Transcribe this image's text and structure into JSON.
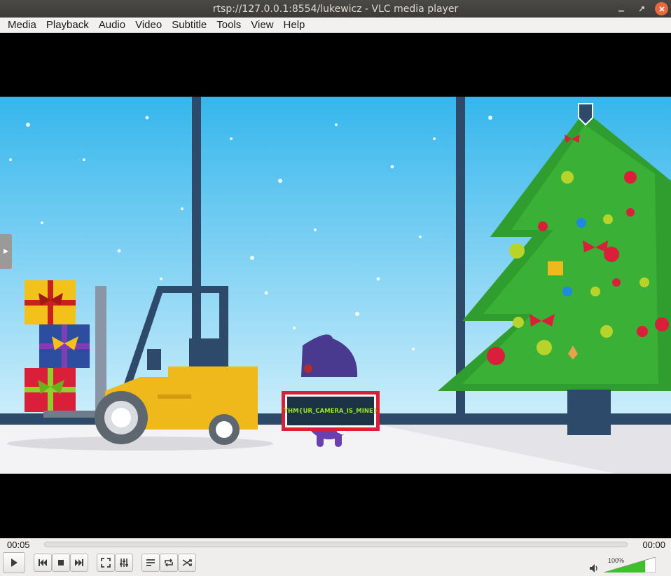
{
  "window": {
    "title": "rtsp://127.0.0.1:8554/lukewicz - VLC media player"
  },
  "menu": [
    "Media",
    "Playback",
    "Audio",
    "Video",
    "Subtitle",
    "Tools",
    "View",
    "Help"
  ],
  "video": {
    "sign_text": "THM{UR_CAMERA_IS_MINE}"
  },
  "controls": {
    "elapsed": "00:05",
    "total": "00:00",
    "progress": 0,
    "volume_label": "100%",
    "volume_level": 1.0
  },
  "icons": {
    "play": "play-icon",
    "previous": "previous-icon",
    "stop": "stop-icon",
    "next": "next-icon",
    "fullscreen": "fullscreen-icon",
    "extended": "extended-settings-icon",
    "playlist": "playlist-icon",
    "loop": "loop-icon",
    "shuffle": "shuffle-icon",
    "volume": "speaker-icon"
  },
  "colors": {
    "title_bg": "#3c3b37",
    "close_button": "#e9683c",
    "volume_fill": "#3fbf2b"
  }
}
